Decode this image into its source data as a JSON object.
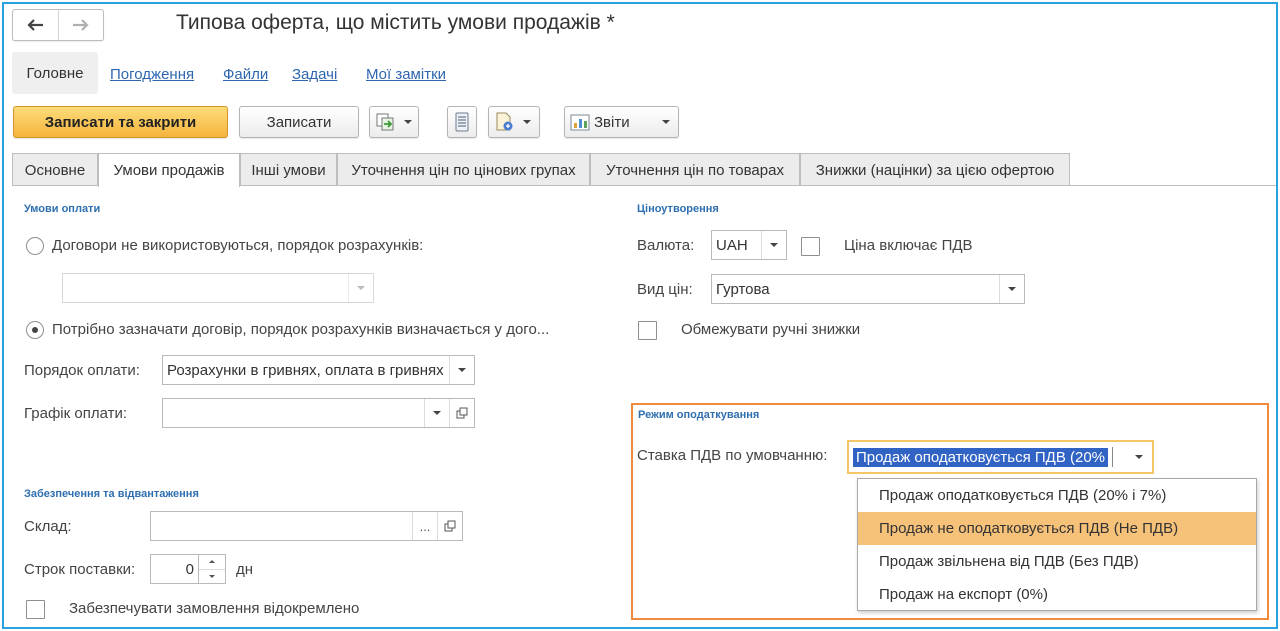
{
  "window": {
    "title": "Типова оферта, що містить умови продажів *"
  },
  "command_panel": {
    "main": "Головне",
    "links": [
      "Погодження",
      "Файли",
      "Задачі",
      "Мої замітки"
    ]
  },
  "toolbar": {
    "save_close": "Записати та закрити",
    "save": "Записати",
    "reports": "Звіти"
  },
  "tabs": [
    "Основне",
    "Умови продажів",
    "Інші умови",
    "Уточнення цін по цінових групах",
    "Уточнення цін по товарах",
    "Знижки (націнки) за цією офертою"
  ],
  "active_tab": "Умови продажів",
  "payment_terms": {
    "group_title": "Умови оплати",
    "radio_no_contracts": "Договори не використовуються, порядок розрахунків:",
    "contracts_field_value": "",
    "radio_contract_required": "Потрібно зазначати договір, порядок розрахунків визначається у дого...",
    "payment_order_label": "Порядок оплати:",
    "payment_order_value": "Розрахунки в гривнях, оплата в гривнях",
    "payment_schedule_label": "Графік оплати:",
    "payment_schedule_value": ""
  },
  "provision": {
    "group_title": "Забезпечення та відвантаження",
    "warehouse_label": "Склад:",
    "warehouse_value": "",
    "delivery_label": "Строк поставки:",
    "delivery_value": "0",
    "delivery_unit": "дн",
    "separate_label": "Забезпечувати замовлення відокремлено"
  },
  "pricing": {
    "group_title": "Ціноутворення",
    "currency_label": "Валюта:",
    "currency_value": "UAH",
    "price_includes_vat": "Ціна включає ПДВ",
    "price_type_label": "Вид цін:",
    "price_type_value": "Гуртова",
    "limit_discounts": "Обмежувати ручні знижки"
  },
  "taxation": {
    "group_title": "Режим оподаткування",
    "vat_label": "Ставка ПДВ по умовчанню:",
    "vat_value": "Продаж оподатковується ПДВ (20%",
    "options": [
      "Продаж оподатковується ПДВ (20% і 7%)",
      "Продаж не оподатковується ПДВ (Не ПДВ)",
      "Продаж звільнена від ПДВ (Без ПДВ)",
      "Продаж на експорт (0%)"
    ],
    "highlighted_option": "Продаж не оподатковується ПДВ (Не ПДВ)"
  }
}
